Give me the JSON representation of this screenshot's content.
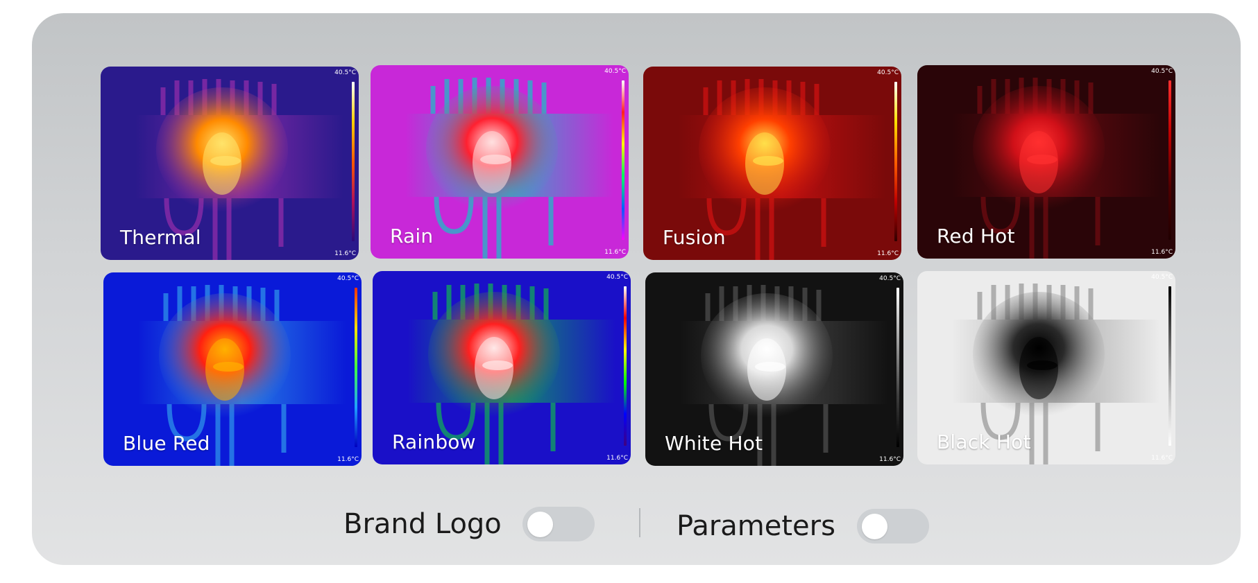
{
  "temp_range": {
    "max": "40.5°C",
    "min": "11.6°C"
  },
  "palettes": [
    {
      "name": "Thermal",
      "bg": "#2a1a8c",
      "mid": "#8a2aa8",
      "hot": "#ff8a00",
      "core": "#ffe36a",
      "scale": [
        "#ffffff",
        "#ffd000",
        "#ff5a00",
        "#b0105a",
        "#2a0a7a"
      ]
    },
    {
      "name": "Rain",
      "bg": "#c828d8",
      "mid": "#2ab0c8",
      "hot": "#ff2030",
      "core": "#ffe0e0",
      "scale": [
        "#ffffff",
        "#ff2020",
        "#ffff00",
        "#00ff60",
        "#0060ff",
        "#ff00ff"
      ]
    },
    {
      "name": "Fusion",
      "bg": "#7a0a0a",
      "mid": "#c81010",
      "hot": "#ff4000",
      "core": "#ffe04a",
      "scale": [
        "#ffffff",
        "#ffe000",
        "#ff6000",
        "#c00000",
        "#300000"
      ]
    },
    {
      "name": "Red Hot",
      "bg": "#2a0508",
      "mid": "#6a0a10",
      "hot": "#d01018",
      "core": "#ff3030",
      "scale": [
        "#ff3030",
        "#c00000",
        "#500000",
        "#200000"
      ]
    },
    {
      "name": "Blue Red",
      "bg": "#0a1ad8",
      "mid": "#2a8ae8",
      "hot": "#ff2010",
      "core": "#ffb000",
      "scale": [
        "#ff3000",
        "#ffe000",
        "#40ff40",
        "#20a0ff",
        "#0000c0"
      ]
    },
    {
      "name": "Rainbow",
      "bg": "#1a10c8",
      "mid": "#10a060",
      "hot": "#ff2020",
      "core": "#ffe8e8",
      "scale": [
        "#ffffff",
        "#ff0000",
        "#ffff00",
        "#00ff00",
        "#0000ff",
        "#400080"
      ]
    },
    {
      "name": "White Hot",
      "bg": "#121212",
      "mid": "#4a4a4a",
      "hot": "#d8d8d8",
      "core": "#ffffff",
      "scale": [
        "#ffffff",
        "#a0a0a0",
        "#404040",
        "#000000"
      ]
    },
    {
      "name": "Black Hot",
      "bg": "#ececec",
      "mid": "#a0a0a0",
      "hot": "#2a2a2a",
      "core": "#000000",
      "scale": [
        "#000000",
        "#606060",
        "#c0c0c0",
        "#ffffff"
      ]
    }
  ],
  "toggles": {
    "brand_logo": {
      "label": "Brand Logo",
      "on": false
    },
    "parameters": {
      "label": "Parameters",
      "on": false
    }
  }
}
